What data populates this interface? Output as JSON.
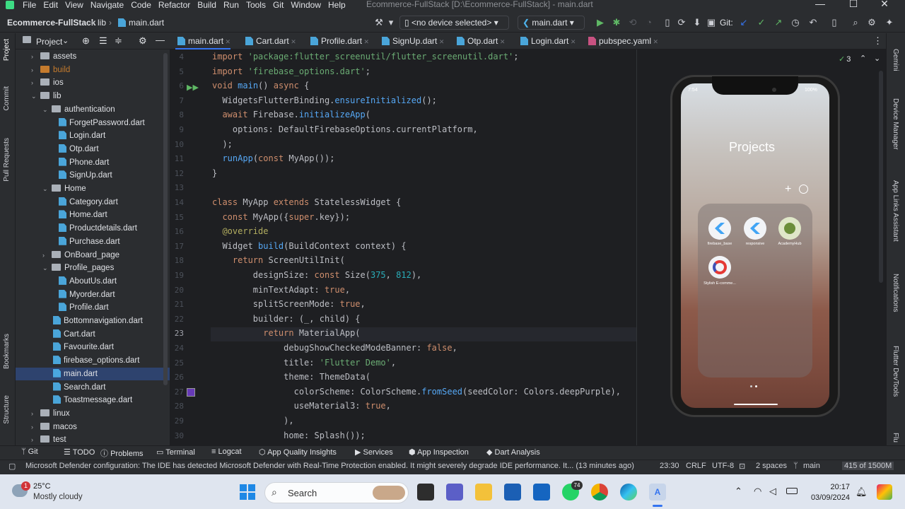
{
  "menu": {
    "items": [
      "File",
      "Edit",
      "View",
      "Navigate",
      "Code",
      "Refactor",
      "Build",
      "Run",
      "Tools",
      "Git",
      "Window",
      "Help"
    ],
    "title": "Ecommerce-FullStack [D:\\Ecommerce-FullStack] - main.dart"
  },
  "toolbar": {
    "project": "Ecommerce-FullStack",
    "folder": "lib",
    "file": "main.dart",
    "device": "<no device selected>",
    "run_config": "main.dart",
    "git_label": "Git:"
  },
  "project_panel": {
    "title": "Project"
  },
  "tree": [
    {
      "label": "assets",
      "depth": 1,
      "kind": "folder",
      "arrow": "›"
    },
    {
      "label": "build",
      "depth": 1,
      "kind": "folder-orange",
      "arrow": "›"
    },
    {
      "label": "ios",
      "depth": 1,
      "kind": "folder",
      "arrow": "›"
    },
    {
      "label": "lib",
      "depth": 1,
      "kind": "folder",
      "arrow": "⌄"
    },
    {
      "label": "authentication",
      "depth": 2,
      "kind": "folder",
      "arrow": "⌄"
    },
    {
      "label": "ForgetPassword.dart",
      "depth": 3,
      "kind": "file"
    },
    {
      "label": "Login.dart",
      "depth": 3,
      "kind": "file"
    },
    {
      "label": "Otp.dart",
      "depth": 3,
      "kind": "file"
    },
    {
      "label": "Phone.dart",
      "depth": 3,
      "kind": "file"
    },
    {
      "label": "SignUp.dart",
      "depth": 3,
      "kind": "file"
    },
    {
      "label": "Home",
      "depth": 2,
      "kind": "folder",
      "arrow": "⌄"
    },
    {
      "label": "Category.dart",
      "depth": 3,
      "kind": "file"
    },
    {
      "label": "Home.dart",
      "depth": 3,
      "kind": "file"
    },
    {
      "label": "Productdetails.dart",
      "depth": 3,
      "kind": "file"
    },
    {
      "label": "Purchase.dart",
      "depth": 3,
      "kind": "file"
    },
    {
      "label": "OnBoard_page",
      "depth": 2,
      "kind": "folder",
      "arrow": "›"
    },
    {
      "label": "Profile_pages",
      "depth": 2,
      "kind": "folder",
      "arrow": "⌄"
    },
    {
      "label": "AboutUs.dart",
      "depth": 3,
      "kind": "file"
    },
    {
      "label": "Myorder.dart",
      "depth": 3,
      "kind": "file"
    },
    {
      "label": "Profile.dart",
      "depth": 3,
      "kind": "file"
    },
    {
      "label": "Bottomnavigation.dart",
      "depth": 2,
      "kind": "file"
    },
    {
      "label": "Cart.dart",
      "depth": 2,
      "kind": "file"
    },
    {
      "label": "Favourite.dart",
      "depth": 2,
      "kind": "file"
    },
    {
      "label": "firebase_options.dart",
      "depth": 2,
      "kind": "file"
    },
    {
      "label": "main.dart",
      "depth": 2,
      "kind": "file",
      "selected": true
    },
    {
      "label": "Search.dart",
      "depth": 2,
      "kind": "file"
    },
    {
      "label": "Toastmessage.dart",
      "depth": 2,
      "kind": "file"
    },
    {
      "label": "linux",
      "depth": 1,
      "kind": "folder",
      "arrow": "›"
    },
    {
      "label": "macos",
      "depth": 1,
      "kind": "folder",
      "arrow": "›"
    },
    {
      "label": "test",
      "depth": 1,
      "kind": "folder",
      "arrow": "›"
    }
  ],
  "tabs": [
    {
      "label": "main.dart",
      "active": true
    },
    {
      "label": "Cart.dart"
    },
    {
      "label": "Profile.dart"
    },
    {
      "label": "SignUp.dart"
    },
    {
      "label": "Otp.dart"
    },
    {
      "label": "Login.dart"
    },
    {
      "label": "pubspec.yaml"
    }
  ],
  "editor": {
    "warnings": "3",
    "lines": [
      {
        "n": "4",
        "html": "<span class='kw'>import</span> <span class='str'>'package:flutter_screenutil/flutter_screenutil.dart'</span>;"
      },
      {
        "n": "5",
        "html": "<span class='kw'>import</span> <span class='str'>'firebase_options.dart'</span>;"
      },
      {
        "n": "6",
        "html": "<span class='kw'>void</span> <span class='fn'>main</span>() <span class='kw'>async</span> {"
      },
      {
        "n": "7",
        "html": "  WidgetsFlutterBinding.<span class='fn'>ensureInitialized</span>();"
      },
      {
        "n": "8",
        "html": "  <span class='kw'>await</span> Firebase.<span class='fn'>initializeApp</span>("
      },
      {
        "n": "9",
        "html": "    options: DefaultFirebaseOptions.currentPlatform,"
      },
      {
        "n": "10",
        "html": "  );"
      },
      {
        "n": "11",
        "html": "  <span class='fn'>runApp</span>(<span class='kw'>const</span> MyApp());"
      },
      {
        "n": "12",
        "html": "}"
      },
      {
        "n": "13",
        "html": ""
      },
      {
        "n": "14",
        "html": "<span class='kw'>class</span> MyApp <span class='kw'>extends</span> StatelessWidget {"
      },
      {
        "n": "15",
        "html": "  <span class='kw'>const</span> MyApp({<span class='kw'>super</span>.key});"
      },
      {
        "n": "16",
        "html": "  <span class='ann'>@override</span>"
      },
      {
        "n": "17",
        "html": "  Widget <span class='fn'>build</span>(BuildContext context) {"
      },
      {
        "n": "18",
        "html": "    <span class='kw'>return</span> ScreenUtilInit("
      },
      {
        "n": "19",
        "html": "        designSize: <span class='kw'>const</span> Size(<span class='num'>375</span>, <span class='num'>812</span>),"
      },
      {
        "n": "20",
        "html": "        minTextAdapt: <span class='kw'>true</span>,"
      },
      {
        "n": "21",
        "html": "        splitScreenMode: <span class='kw'>true</span>,"
      },
      {
        "n": "22",
        "html": "        builder: (_, child) {"
      },
      {
        "n": "23",
        "html": "          <span class='kw'>return</span> MaterialApp("
      },
      {
        "n": "24",
        "html": "              debugShowCheckedModeBanner: <span class='kw'>false</span>,"
      },
      {
        "n": "25",
        "html": "              title: <span class='str'>'Flutter Demo'</span>,"
      },
      {
        "n": "26",
        "html": "              theme: ThemeData("
      },
      {
        "n": "27",
        "html": "                colorScheme: ColorScheme.<span class='fn'>fromSeed</span>(seedColor: Colors.deepPurple),"
      },
      {
        "n": "28",
        "html": "                useMaterial3: <span class='kw'>true</span>,"
      },
      {
        "n": "29",
        "html": "              ),"
      },
      {
        "n": "30",
        "html": "              home: Splash());"
      }
    ]
  },
  "emulator": {
    "time": "7:54",
    "battery": "100%",
    "title": "Projects",
    "apps": [
      {
        "label": "firebase_base"
      },
      {
        "label": "responsive"
      },
      {
        "label": "AcademyHub"
      },
      {
        "label": "Stylish E-comme..."
      }
    ]
  },
  "bottom_tools": [
    "Git",
    "TODO",
    "Problems",
    "Terminal",
    "Logcat",
    "App Quality Insights",
    "Services",
    "App Inspection",
    "Dart Analysis"
  ],
  "status": {
    "message": "Microsoft Defender configuration: The IDE has detected Microsoft Defender with Real-Time Protection enabled. It might severely degrade IDE performance. It... (13 minutes ago)",
    "position": "23:30",
    "line_sep": "CRLF",
    "encoding": "UTF-8",
    "indent": "2 spaces",
    "branch": "main",
    "memory": "415 of 1500M"
  },
  "right_tools": [
    "Gemini",
    "Device Manager",
    "App Links Assistant",
    "Notifications",
    "Flutter DevTools",
    "Flu"
  ],
  "left_tools": [
    "Project",
    "Commit",
    "Pull Requests",
    "Bookmarks",
    "Structure"
  ],
  "taskbar": {
    "weather_temp": "25°C",
    "weather_desc": "Mostly cloudy",
    "weather_badge": "1",
    "search_placeholder": "Search",
    "whatsapp_badge": "74",
    "time": "20:17",
    "date": "03/09/2024"
  }
}
